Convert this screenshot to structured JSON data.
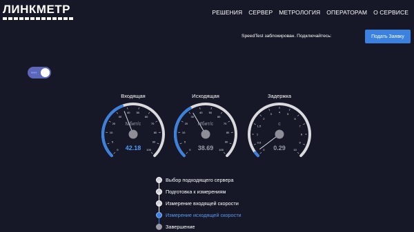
{
  "brand": {
    "name": "ЛИНКМЕТР"
  },
  "nav": [
    "РЕШЕНИЯ",
    "СЕРВЕР",
    "МЕТРОЛОГИЯ",
    "ОПЕРАТОРАМ",
    "О СЕРВИСЕ"
  ],
  "notice": "SpeedTest заблокирован. Подключайтесь:",
  "apply_button": "Подать Заявку",
  "toggle": {
    "state": "on"
  },
  "gauges": [
    {
      "title": "Входящая",
      "unit": "Мбит/с",
      "value": "42.18",
      "ticks": [
        "0",
        "5",
        "10",
        "20",
        "30",
        "40",
        "50",
        "60",
        "70",
        "80",
        "90",
        "100"
      ],
      "needle": 42.18,
      "max": 100,
      "value_color": "#4f9cf5"
    },
    {
      "title": "Исходящая",
      "unit": "Мбит/с",
      "value": "38.69",
      "ticks": [
        "0",
        "5",
        "10",
        "20",
        "30",
        "40",
        "50",
        "60",
        "70",
        "80",
        "90",
        "100"
      ],
      "needle": 38.69,
      "max": 100,
      "value_color": "#9a9aa6"
    },
    {
      "title": "Задержка",
      "unit": "с",
      "value": "0.29",
      "ticks": [
        "0",
        "0.5",
        "1",
        "1.5",
        "2",
        "3",
        "4",
        "5",
        "6",
        "7",
        "8",
        "9",
        "10"
      ],
      "needle": 0.29,
      "max": 10,
      "value_color": "#9a9aa6"
    }
  ],
  "steps": [
    {
      "label": "Выбор подходящего сервера",
      "state": "done"
    },
    {
      "label": "Подготовка к измерениям",
      "state": "done"
    },
    {
      "label": "Измерение входящей скорости",
      "state": "done"
    },
    {
      "label": "Измерение исходящей скорости",
      "state": "active"
    },
    {
      "label": "Завершение",
      "state": "pending"
    }
  ],
  "colors": {
    "background": "#161828",
    "accent": "#3b82e0",
    "arc_inactive": "#d9d9de"
  }
}
